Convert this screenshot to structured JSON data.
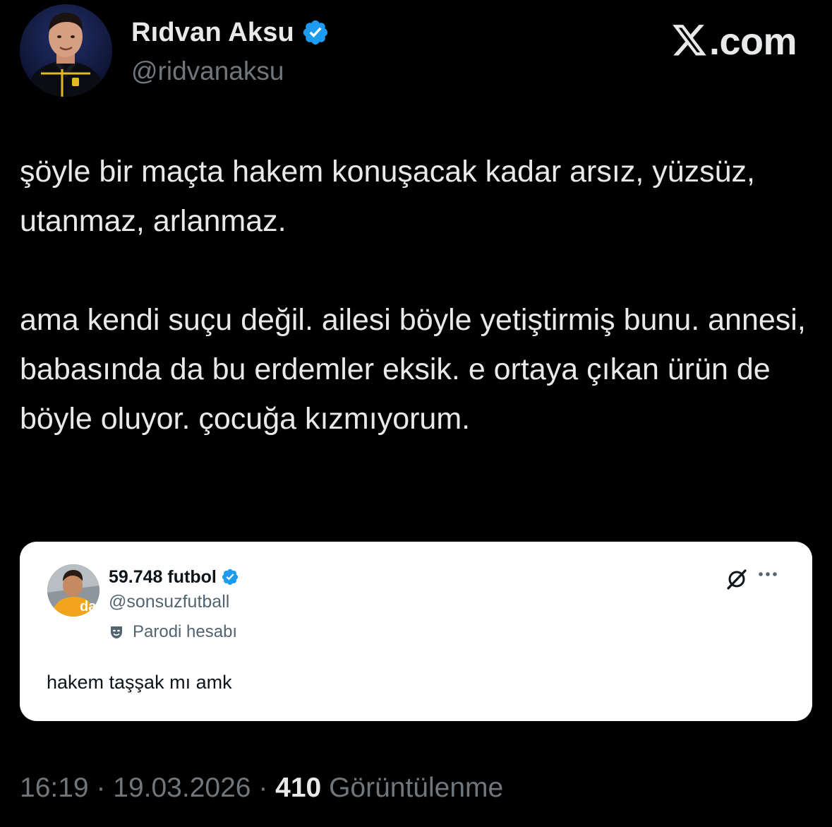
{
  "author": {
    "display_name": "Rıdvan Aksu",
    "handle": "@ridvanaksu"
  },
  "brand": {
    "label": ".com",
    "icon": "x-logo-icon"
  },
  "tweet": {
    "paragraph_1": "şöyle bir maçta hakem konuşacak kadar arsız, yüzsüz, utanmaz, arlanmaz.",
    "paragraph_2": "ama kendi suçu değil. ailesi böyle yetiştirmiş bunu. annesi, babasında da bu erdemler eksik. e ortaya çıkan ürün de böyle oluyor. çocuğa kızmıyorum."
  },
  "quoted": {
    "display_name": "59.748 futbol",
    "handle": "@sonsuzfutball",
    "label": "Parodi hesabı",
    "text": "hakem taşşak mı amk"
  },
  "meta": {
    "time": "16:19",
    "separator": " · ",
    "date": "19.03.2026",
    "views_count": "410",
    "views_label": "Görüntülenme"
  },
  "colors": {
    "background": "#000000",
    "text": "#e7e9ea",
    "secondary": "#71767b",
    "verified": "#1d9bf0",
    "card_background": "#ffffff"
  }
}
